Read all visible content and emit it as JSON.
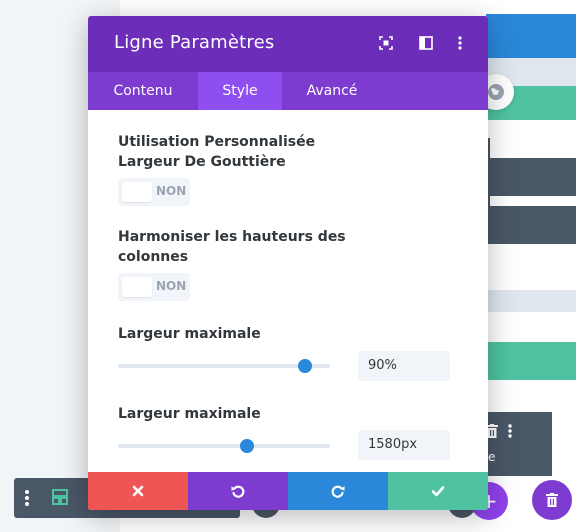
{
  "modal": {
    "title": "Ligne Paramètres",
    "tabs": [
      {
        "label": "Contenu",
        "active": false
      },
      {
        "label": "Style",
        "active": true
      },
      {
        "label": "Avancé",
        "active": false
      }
    ],
    "header_icons": [
      "fullscreen-icon",
      "split-view-icon",
      "more-options-icon"
    ]
  },
  "settings": {
    "gutter": {
      "label": "Utilisation Personnalisée Largeur De Gouttière",
      "toggle_text": "NON",
      "enabled": false
    },
    "equalize": {
      "label": "Harmoniser les hauteurs des colonnes",
      "toggle_text": "NON",
      "enabled": false
    },
    "max_width_1": {
      "label": "Largeur maximale",
      "value": "90%",
      "slider_fraction": 0.88
    },
    "max_width_2": {
      "label": "Largeur maximale",
      "value": "1580px",
      "slider_fraction": 0.61
    }
  },
  "footer": {
    "buttons": [
      "cancel-icon",
      "undo-icon",
      "redo-icon",
      "save-icon"
    ],
    "colors": {
      "cancel": "#ef5555",
      "undo": "#7e3bd0",
      "redo": "#2b87da",
      "save": "#4fc3a1"
    }
  },
  "background": {
    "module_label": "e",
    "add_glyph": "+"
  },
  "colors": {
    "header": "#6c2eb9",
    "tabs": "#7e3bd0",
    "accent_blue": "#2b87da",
    "accent_teal": "#4fc3a1"
  }
}
